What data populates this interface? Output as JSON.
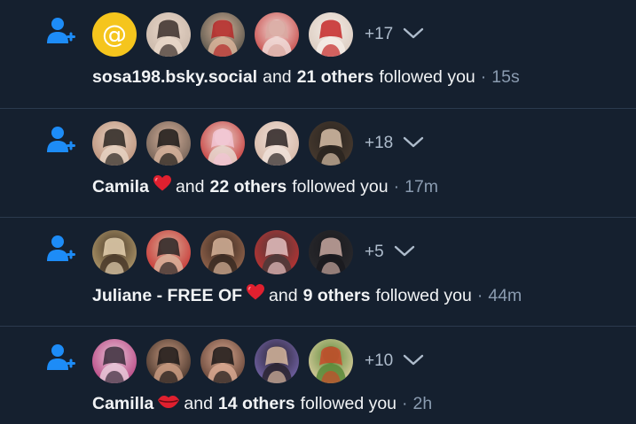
{
  "colors": {
    "background": "#15202f",
    "divider": "#2b3a4e",
    "accent_blue": "#1d8cf7",
    "muted_text": "#8a9bb0",
    "heart_red": "#e0202f",
    "at_avatar_yellow": "#f5c51d"
  },
  "notifications": [
    {
      "icon": "person-add-icon",
      "avatars": [
        {
          "kind": "at-symbol",
          "glyph": "@",
          "color": "#f5c51d"
        },
        {
          "kind": "photo",
          "palette": [
            "#c8b6a8",
            "#3a2e2a",
            "#e8d6c8"
          ]
        },
        {
          "kind": "photo",
          "palette": [
            "#4a4a42",
            "#b42828",
            "#d8b49a"
          ]
        },
        {
          "kind": "photo",
          "palette": [
            "#c43c3a",
            "#d8a8a0",
            "#f0dcd8"
          ]
        },
        {
          "kind": "photo",
          "palette": [
            "#d8c8bc",
            "#c42828",
            "#f4ece6"
          ]
        }
      ],
      "more_count": "+17",
      "actor": "sosa198.bsky.social",
      "actor_emoji": "",
      "connector": "and",
      "others": "21 others",
      "action": "followed you",
      "separator": "·",
      "time": "15s"
    },
    {
      "icon": "person-add-icon",
      "avatars": [
        {
          "kind": "photo",
          "palette": [
            "#b88c74",
            "#2a2420",
            "#e6d2c2"
          ]
        },
        {
          "kind": "photo",
          "palette": [
            "#6a5a50",
            "#1a1816",
            "#d4b09a"
          ]
        },
        {
          "kind": "photo",
          "palette": [
            "#c42c2c",
            "#f2c4d4",
            "#e8d8d0"
          ]
        },
        {
          "kind": "photo",
          "palette": [
            "#d4b4a2",
            "#2a2222",
            "#efe0d8"
          ]
        },
        {
          "kind": "photo",
          "palette": [
            "#4a3c30",
            "#d8c0a8",
            "#2a2420"
          ]
        }
      ],
      "more_count": "+18",
      "actor": "Camila",
      "actor_emoji": "heart",
      "connector": "and",
      "others": "22 others",
      "action": "followed you",
      "separator": "·",
      "time": "17m"
    },
    {
      "icon": "person-add-icon",
      "avatars": [
        {
          "kind": "photo",
          "palette": [
            "#b8a070",
            "#e6d2b0",
            "#4a3a2a"
          ]
        },
        {
          "kind": "photo",
          "palette": [
            "#c82a2a",
            "#2a2222",
            "#d8b09a"
          ]
        },
        {
          "kind": "photo",
          "palette": [
            "#9c6a50",
            "#d8b49a",
            "#3a2a22"
          ]
        },
        {
          "kind": "photo",
          "palette": [
            "#c83232",
            "#e8c0c0",
            "#4a3a3a"
          ]
        },
        {
          "kind": "photo",
          "palette": [
            "#2a2a2e",
            "#c8a8a0",
            "#1a1a1e"
          ]
        }
      ],
      "more_count": "+5",
      "actor": "Juliane - FREE OF",
      "actor_emoji": "heart",
      "connector": "and",
      "others": "9 others",
      "action": "followed you",
      "separator": "·",
      "time": "44m"
    },
    {
      "icon": "person-add-icon",
      "avatars": [
        {
          "kind": "photo",
          "palette": [
            "#b4387a",
            "#3a2a3a",
            "#e8c8d8"
          ]
        },
        {
          "kind": "photo",
          "palette": [
            "#3a2a22",
            "#1a1616",
            "#c89a80"
          ]
        },
        {
          "kind": "photo",
          "palette": [
            "#5a3a2e",
            "#1a1616",
            "#d8a890"
          ]
        },
        {
          "kind": "photo",
          "palette": [
            "#7a6ab4",
            "#d8b8a0",
            "#2a2430"
          ]
        },
        {
          "kind": "photo",
          "palette": [
            "#e8d4a8",
            "#c84a2a",
            "#5a8a3a"
          ]
        }
      ],
      "more_count": "+10",
      "actor": "Camilla",
      "actor_emoji": "lips",
      "connector": "and",
      "others": "14 others",
      "action": "followed you",
      "separator": "·",
      "time": "2h"
    }
  ]
}
